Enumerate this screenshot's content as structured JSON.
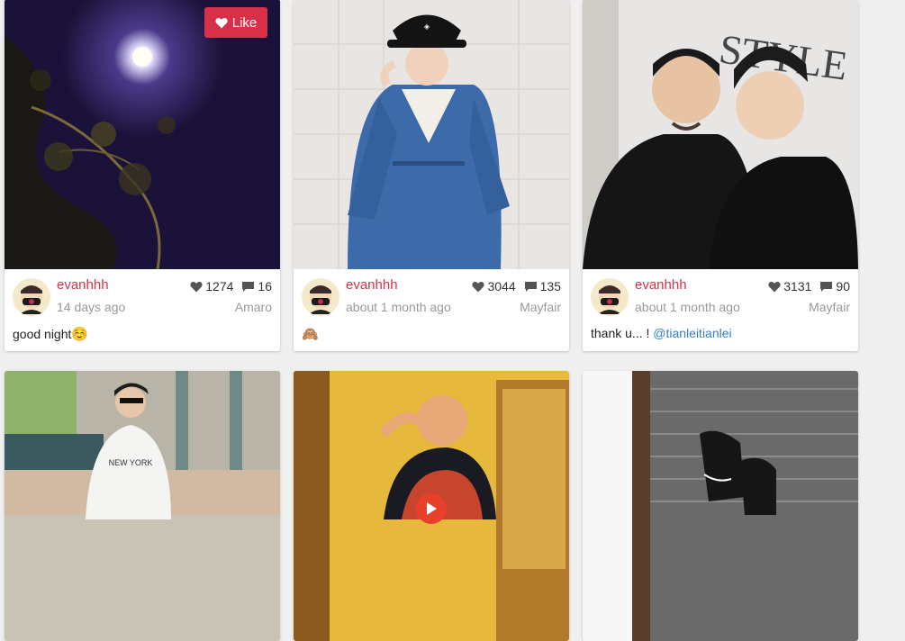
{
  "like_button": {
    "label": "Like",
    "icon": "heart-icon"
  },
  "posts": [
    {
      "username": "evanhhh",
      "time": "14 days ago",
      "likes": "1274",
      "comments": "16",
      "filter": "Amaro",
      "caption": "good night",
      "caption_emoji": "☺️",
      "mention": ""
    },
    {
      "username": "evanhhh",
      "time": "about 1 month ago",
      "likes": "3044",
      "comments": "135",
      "filter": "Mayfair",
      "caption": "",
      "caption_emoji": "🙈",
      "mention": ""
    },
    {
      "username": "evanhhh",
      "time": "about 1 month ago",
      "likes": "3131",
      "comments": "90",
      "filter": "Mayfair",
      "caption": "thank u... ! ",
      "caption_emoji": "",
      "mention": "@tianleitianlei"
    }
  ],
  "colors": {
    "accent": "#d9304a",
    "username": "#d2344a",
    "mention": "#3a7fc1",
    "muted": "#999999",
    "page_bg": "#efefef",
    "play": "#e8402a"
  },
  "icons": [
    "heart-icon",
    "comment-icon",
    "play-icon"
  ]
}
